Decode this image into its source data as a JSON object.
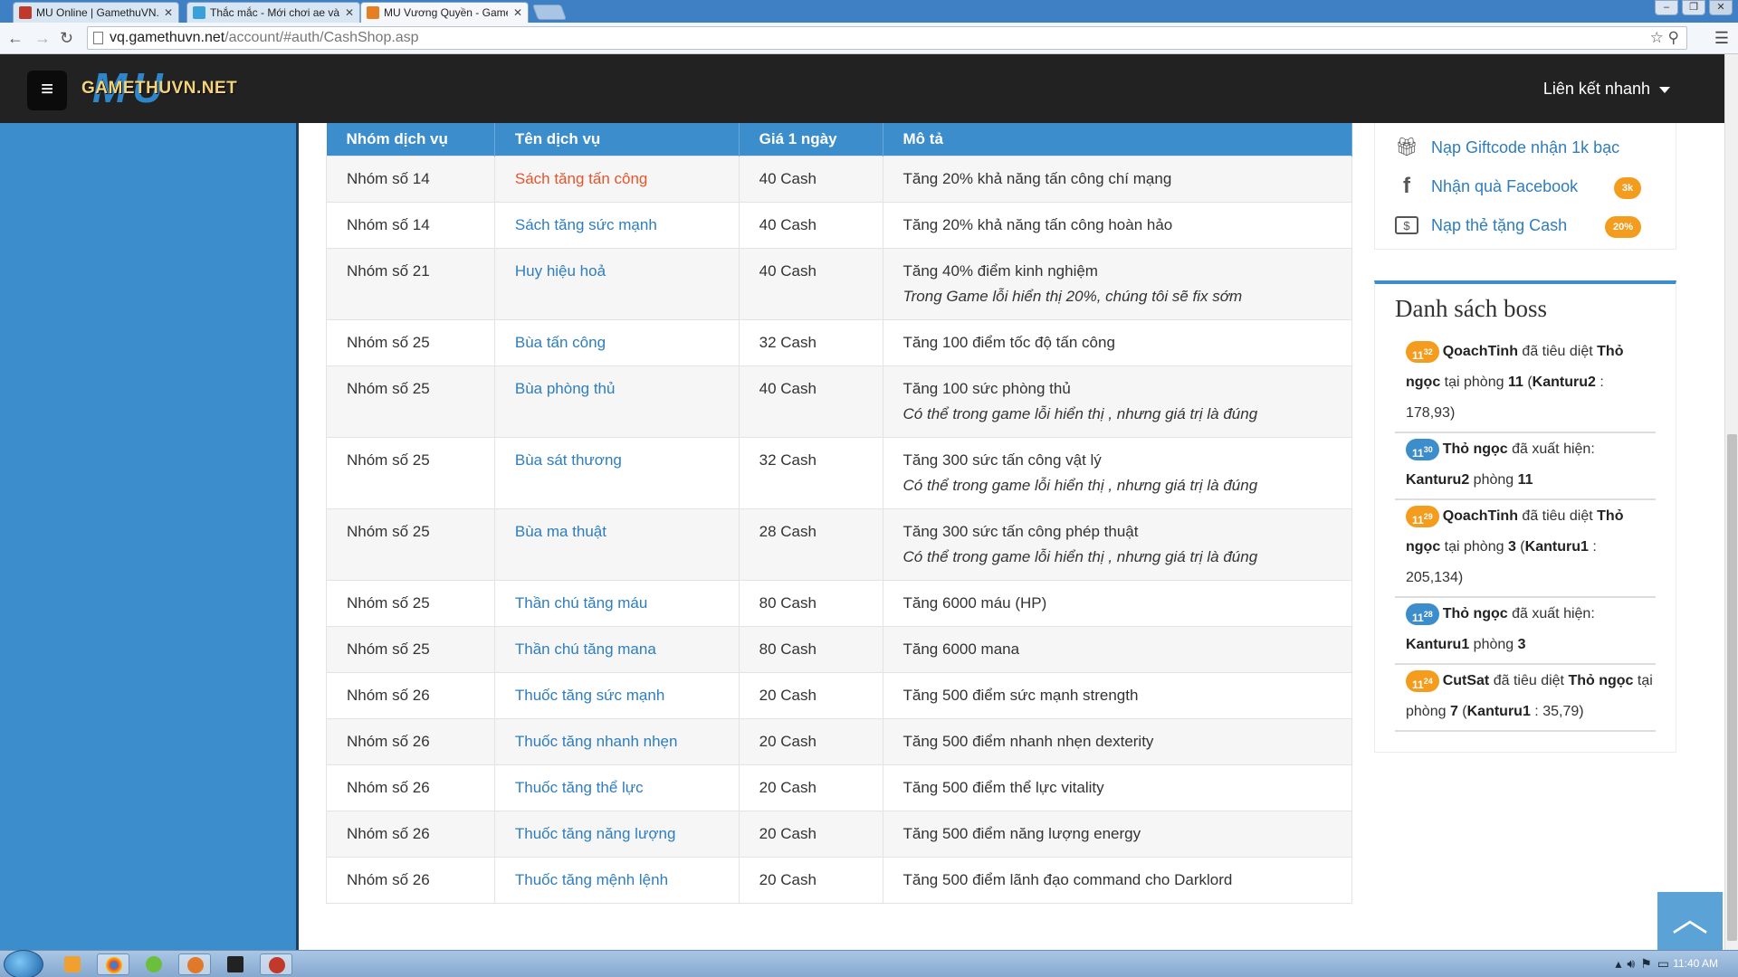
{
  "browser": {
    "tabs": [
      {
        "title": "MU Online | GamethuVN.N",
        "active": false,
        "color": "#c0392b"
      },
      {
        "title": "Thắc mắc - Mới chơi ae vào",
        "active": false,
        "color": "#3aa0d8"
      },
      {
        "title": "MU Vương Quyền - Game",
        "active": true,
        "color": "#e67e22"
      }
    ],
    "url_host": "vq.gamethuvn.net",
    "url_path": "/account/#auth/CashShop.asp"
  },
  "nav": {
    "logo_text": "GAMETHUVN.NET",
    "logo_mark": "MU",
    "quick_links": "Liên kết nhanh"
  },
  "table": {
    "headers": [
      "Nhóm dịch vụ",
      "Tên dịch vụ",
      "Giá 1 ngày",
      "Mô tả"
    ],
    "rows": [
      {
        "group": "Nhóm số 14",
        "name": "Sách tăng tấn công",
        "price": "40 Cash",
        "desc": "Tăng 20% khả năng tấn công chí mạng",
        "note": ""
      },
      {
        "group": "Nhóm số 14",
        "name": "Sách tăng sức mạnh",
        "price": "40 Cash",
        "desc": "Tăng 20% khả năng tấn công hoàn hảo",
        "note": ""
      },
      {
        "group": "Nhóm số 21",
        "name": "Huy hiệu hoả",
        "price": "40 Cash",
        "desc": "Tăng 40% điểm kinh nghiệm",
        "note": "Trong Game lỗi hiển thị 20%, chúng tôi sẽ fix sớm"
      },
      {
        "group": "Nhóm số 25",
        "name": "Bùa tấn công",
        "price": "32 Cash",
        "desc": "Tăng 100 điểm tốc độ tấn công",
        "note": ""
      },
      {
        "group": "Nhóm số 25",
        "name": "Bùa phòng thủ",
        "price": "40 Cash",
        "desc": "Tăng 100 sức phòng thủ",
        "note": "Có thể trong game lỗi hiển thị , nhưng giá trị là đúng"
      },
      {
        "group": "Nhóm số 25",
        "name": "Bùa sát thương",
        "price": "32 Cash",
        "desc": "Tăng 300 sức tấn công vật lý",
        "note": "Có thể trong game lỗi hiển thị , nhưng giá trị là đúng"
      },
      {
        "group": "Nhóm số 25",
        "name": "Bùa ma thuật",
        "price": "28 Cash",
        "desc": "Tăng 300 sức tấn công phép thuật",
        "note": "Có thể trong game lỗi hiển thị , nhưng giá trị là đúng"
      },
      {
        "group": "Nhóm số 25",
        "name": "Thần chú tăng máu",
        "price": "80 Cash",
        "desc": "Tăng 6000 máu (HP)",
        "note": ""
      },
      {
        "group": "Nhóm số 25",
        "name": "Thần chú tăng mana",
        "price": "80 Cash",
        "desc": "Tăng 6000 mana",
        "note": ""
      },
      {
        "group": "Nhóm số 26",
        "name": "Thuốc tăng sức mạnh",
        "price": "20 Cash",
        "desc": "Tăng 500 điểm sức mạnh strength",
        "note": ""
      },
      {
        "group": "Nhóm số 26",
        "name": "Thuốc tăng nhanh nhẹn",
        "price": "20 Cash",
        "desc": "Tăng 500 điểm nhanh nhẹn dexterity",
        "note": ""
      },
      {
        "group": "Nhóm số 26",
        "name": "Thuốc tăng thể lực",
        "price": "20 Cash",
        "desc": "Tăng 500 điểm thể lực vitality",
        "note": ""
      },
      {
        "group": "Nhóm số 26",
        "name": "Thuốc tăng năng lượng",
        "price": "20 Cash",
        "desc": "Tăng 500 điểm năng lượng energy",
        "note": ""
      },
      {
        "group": "Nhóm số 26",
        "name": "Thuốc tăng mệnh lệnh",
        "price": "20 Cash",
        "desc": "Tăng 500 điểm lãnh đạo command cho Darklord",
        "note": ""
      }
    ]
  },
  "promos": [
    {
      "label": "Nạp Giftcode nhận 1k bạc",
      "icon": "gift-icon",
      "badge": ""
    },
    {
      "label": "Nhận quà Facebook",
      "icon": "facebook-icon",
      "badge": "3k"
    },
    {
      "label": "Nạp thẻ tặng Cash",
      "icon": "money-icon",
      "badge": "20%"
    }
  ],
  "boss": {
    "title": "Danh sách boss",
    "events": [
      {
        "hour": "11",
        "min": "32",
        "type": "kill",
        "parts": [
          [
            "b",
            "QoachTinh"
          ],
          [
            "t",
            " đã tiêu diệt "
          ],
          [
            "b",
            "Thỏ ngọc"
          ],
          [
            "t",
            " tại phòng "
          ],
          [
            "b",
            "11"
          ],
          [
            "t",
            " ("
          ],
          [
            "b",
            "Kanturu2"
          ],
          [
            "t",
            " : 178,93)"
          ]
        ]
      },
      {
        "hour": "11",
        "min": "30",
        "type": "appear",
        "parts": [
          [
            "b",
            "Thỏ ngọc"
          ],
          [
            "t",
            " đã xuất hiện: "
          ],
          [
            "b",
            "Kanturu2"
          ],
          [
            "t",
            " phòng "
          ],
          [
            "b",
            "11"
          ]
        ]
      },
      {
        "hour": "11",
        "min": "29",
        "type": "kill",
        "parts": [
          [
            "b",
            "QoachTinh"
          ],
          [
            "t",
            " đã tiêu diệt "
          ],
          [
            "b",
            "Thỏ ngọc"
          ],
          [
            "t",
            " tại phòng "
          ],
          [
            "b",
            "3"
          ],
          [
            "t",
            " ("
          ],
          [
            "b",
            "Kanturu1"
          ],
          [
            "t",
            " : 205,134)"
          ]
        ]
      },
      {
        "hour": "11",
        "min": "28",
        "type": "appear",
        "parts": [
          [
            "b",
            "Thỏ ngọc"
          ],
          [
            "t",
            " đã xuất hiện: "
          ],
          [
            "b",
            "Kanturu1"
          ],
          [
            "t",
            " phòng "
          ],
          [
            "b",
            "3"
          ]
        ]
      },
      {
        "hour": "11",
        "min": "24",
        "type": "kill",
        "parts": [
          [
            "b",
            "CutSat"
          ],
          [
            "t",
            " đã tiêu diệt "
          ],
          [
            "b",
            "Thỏ ngọc"
          ],
          [
            "t",
            " tại phòng "
          ],
          [
            "b",
            "7"
          ],
          [
            "t",
            " ("
          ],
          [
            "b",
            "Kanturu1"
          ],
          [
            "t",
            " : 35,79)"
          ]
        ]
      }
    ]
  },
  "taskbar": {
    "clock": "11:40 AM"
  },
  "colors": {
    "accent": "#3c8dcc",
    "link": "#2e7dbf",
    "hot_link": "#e8542a",
    "badge": "#f49c1e"
  }
}
